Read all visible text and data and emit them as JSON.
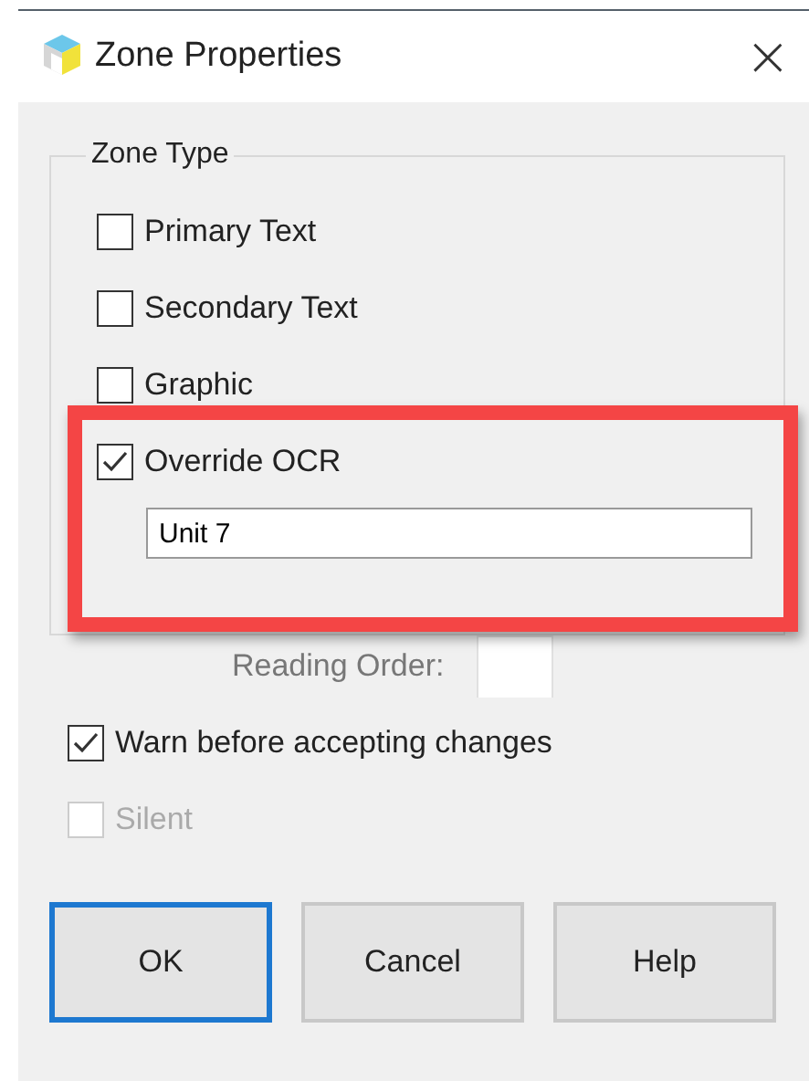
{
  "window": {
    "title": "Zone Properties",
    "close": "×"
  },
  "zone_type": {
    "label": "Zone Type",
    "options": [
      {
        "label": "Primary Text",
        "checked": false
      },
      {
        "label": "Secondary Text",
        "checked": false
      },
      {
        "label": "Graphic",
        "checked": false
      },
      {
        "label": "Override OCR",
        "checked": true
      }
    ],
    "override_value": "Unit 7"
  },
  "reading_order": {
    "label": "Reading Order:"
  },
  "options": [
    {
      "label": "Warn before accepting changes",
      "checked": true,
      "disabled": false
    },
    {
      "label": "Silent",
      "checked": false,
      "disabled": true
    }
  ],
  "buttons": [
    {
      "label": "OK",
      "default": true
    },
    {
      "label": "Cancel",
      "default": false
    },
    {
      "label": "Help",
      "default": false
    }
  ]
}
